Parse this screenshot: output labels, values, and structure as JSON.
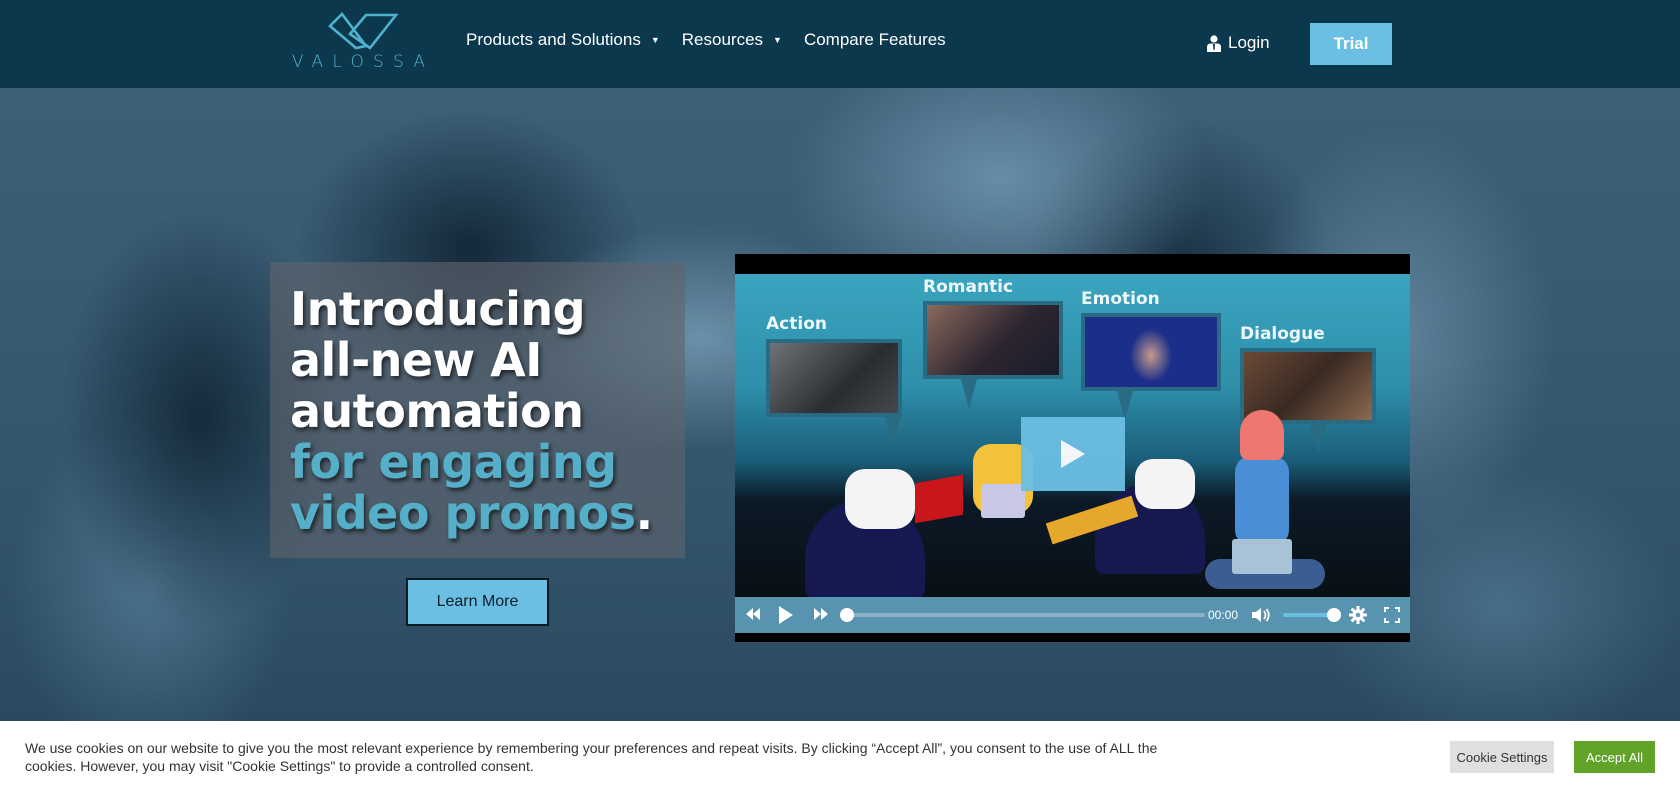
{
  "header": {
    "logo_text": "VALOSSA",
    "nav": [
      {
        "label": "Products and Solutions",
        "has_dropdown": true
      },
      {
        "label": "Resources",
        "has_dropdown": true
      },
      {
        "label": "Compare Features",
        "has_dropdown": false
      }
    ],
    "caret": "▼",
    "login_label": "Login",
    "trial_label": "Trial"
  },
  "hero": {
    "headline_white": "Introducing all-new AI automation ",
    "headline_accent": "for engaging video promos",
    "headline_end": ".",
    "learn_more_label": "Learn More"
  },
  "video": {
    "categories": [
      "Action",
      "Romantic",
      "Emotion",
      "Dialogue"
    ],
    "time": "00:00",
    "progress": 0,
    "volume": 1.0
  },
  "cookie": {
    "text": "We use cookies on our website to give you the most relevant experience by remembering your preferences and repeat visits. By clicking “Accept All”, you consent to the use of ALL the cookies. However, you may visit \"Cookie Settings\" to provide a controlled consent.",
    "settings_label": "Cookie Settings",
    "accept_label": "Accept All"
  },
  "colors": {
    "header_bg": "#0c384d",
    "accent_blue": "#6bbfe3",
    "headline_accent": "#56afc9",
    "accept_green": "#61a229"
  }
}
